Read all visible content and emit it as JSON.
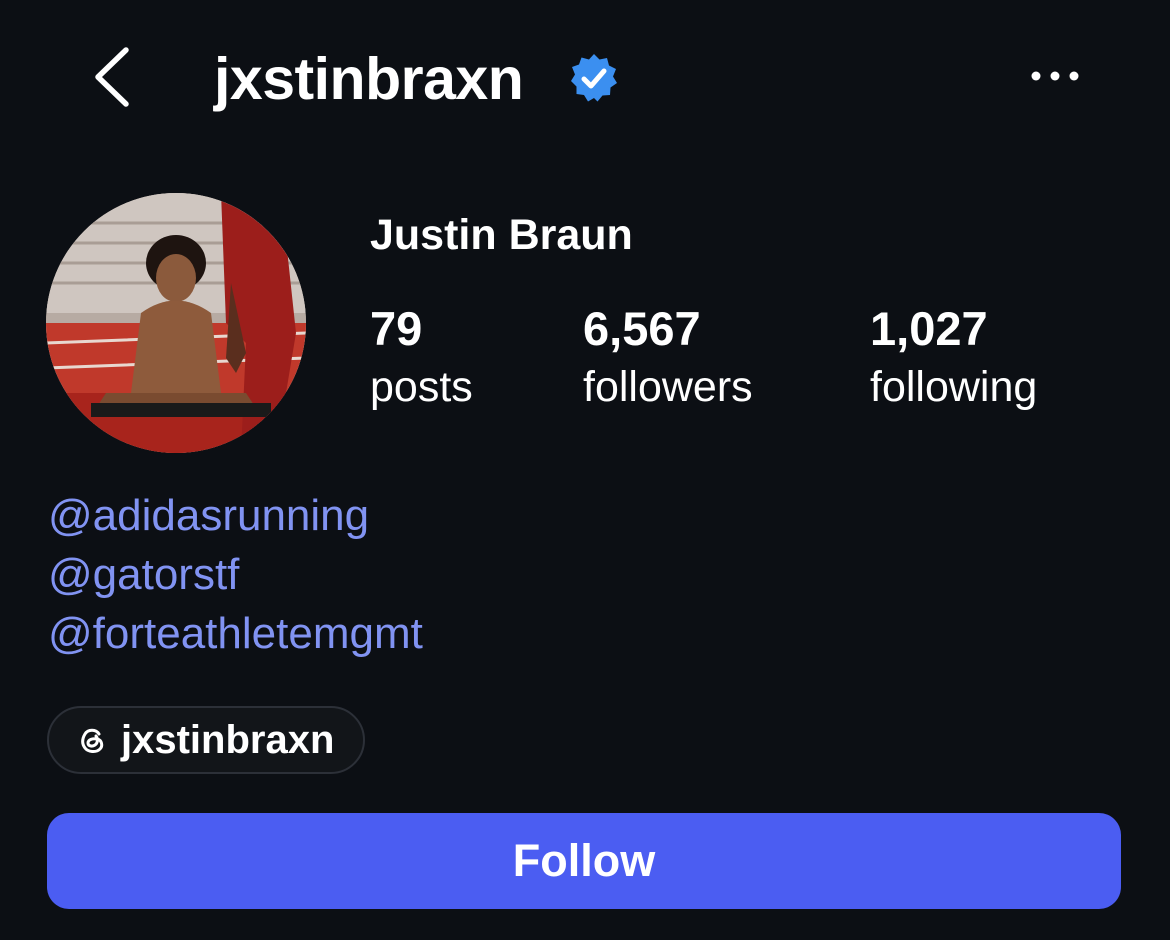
{
  "header": {
    "username": "jxstinbraxn",
    "verified": true,
    "back_icon": "chevron-left-icon",
    "more_icon": "more-horizontal-icon",
    "verified_icon": "verified-badge-icon",
    "verified_color": "#3b8ff0"
  },
  "profile": {
    "display_name": "Justin Braun",
    "stats": [
      {
        "count": "79",
        "label": "posts"
      },
      {
        "count": "6,567",
        "label": "followers"
      },
      {
        "count": "1,027",
        "label": "following"
      }
    ],
    "bio_links": [
      "@adidasrunning",
      "@gatorstf",
      "@forteathletemgmt"
    ],
    "threads_icon": "threads-icon",
    "threads_handle": "jxstinbraxn",
    "follow_label": "Follow"
  },
  "colors": {
    "background": "#0c0f14",
    "link": "#8193f2",
    "follow_button": "#4b5df2"
  }
}
